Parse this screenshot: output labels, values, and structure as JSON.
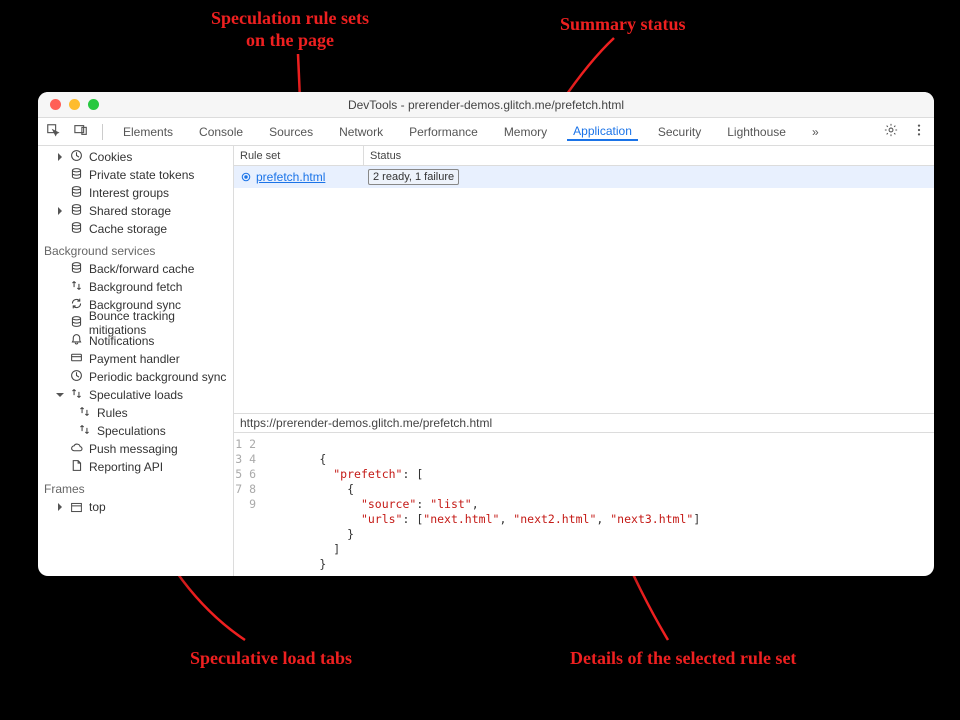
{
  "annotations": {
    "rulesets": "Speculation rule sets\non the page",
    "summary": "Summary status",
    "tabs": "Speculative load tabs",
    "details": "Details of the selected rule set"
  },
  "window": {
    "title": "DevTools - prerender-demos.glitch.me/prefetch.html"
  },
  "toolbar": {
    "tabs": [
      "Elements",
      "Console",
      "Sources",
      "Network",
      "Performance",
      "Memory",
      "Application",
      "Security",
      "Lighthouse"
    ],
    "active": "Application",
    "more": "»"
  },
  "sidebar": {
    "group1": [
      {
        "label": "Cookies",
        "icon": "clock",
        "exp": false
      },
      {
        "label": "Private state tokens",
        "icon": "db"
      },
      {
        "label": "Interest groups",
        "icon": "db"
      },
      {
        "label": "Shared storage",
        "icon": "db",
        "exp": false
      },
      {
        "label": "Cache storage",
        "icon": "db"
      }
    ],
    "section_bg": "Background services",
    "group2": [
      {
        "label": "Back/forward cache",
        "icon": "db"
      },
      {
        "label": "Background fetch",
        "icon": "updown"
      },
      {
        "label": "Background sync",
        "icon": "sync"
      },
      {
        "label": "Bounce tracking mitigations",
        "icon": "db"
      },
      {
        "label": "Notifications",
        "icon": "bell"
      },
      {
        "label": "Payment handler",
        "icon": "card"
      },
      {
        "label": "Periodic background sync",
        "icon": "clock"
      },
      {
        "label": "Speculative loads",
        "icon": "updown",
        "exp": true,
        "children": [
          {
            "label": "Rules",
            "icon": "updown"
          },
          {
            "label": "Speculations",
            "icon": "updown"
          }
        ]
      },
      {
        "label": "Push messaging",
        "icon": "cloud"
      },
      {
        "label": "Reporting API",
        "icon": "doc"
      }
    ],
    "section_frames": "Frames",
    "frame": "top"
  },
  "table": {
    "col1": "Rule set",
    "col2": "Status",
    "row": {
      "ruleset": "prefetch.html",
      "status": "2 ready, 1 failure"
    }
  },
  "pathbar": "https://prerender-demos.glitch.me/prefetch.html",
  "code": {
    "lines": [
      "1",
      "2",
      "3",
      "4",
      "5",
      "6",
      "7",
      "8",
      "9"
    ],
    "text": " \n        {\n          \"prefetch\": [\n            {\n              \"source\": \"list\",\n              \"urls\": [\"next.html\", \"next2.html\", \"next3.html\"]\n            }\n          ]\n        }"
  }
}
